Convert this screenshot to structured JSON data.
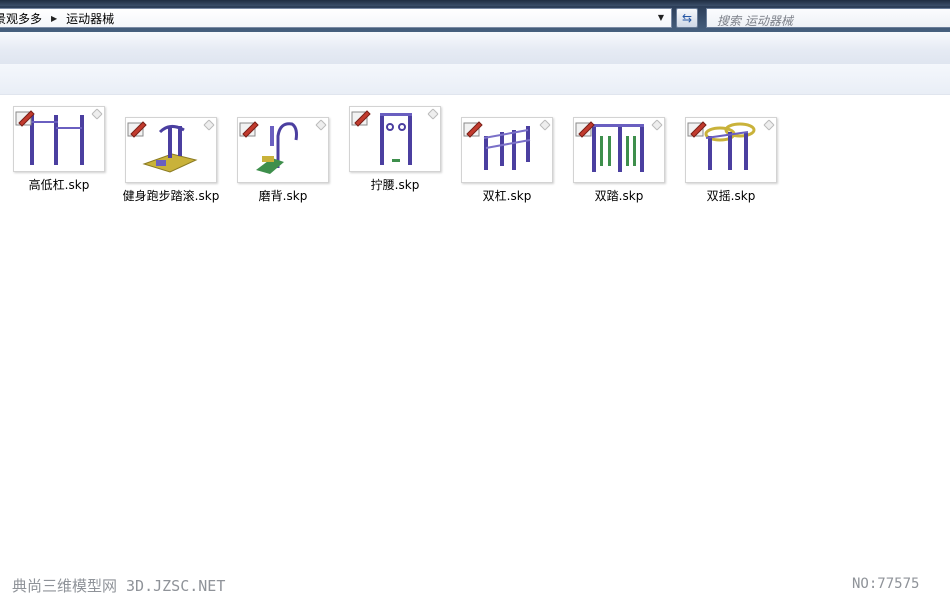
{
  "address": {
    "breadcrumbs": [
      "景观多多",
      "运动器械"
    ],
    "separator": "▶",
    "dropdown_icon": "▼",
    "refresh_icon": "⇆"
  },
  "search": {
    "placeholder": "搜索 运动器械"
  },
  "files": [
    {
      "name": "高低杠.skp",
      "icon": "high-low-bars-thumbnail"
    },
    {
      "name": "健身跑步踏滚.skp",
      "icon": "treadmill-thumbnail"
    },
    {
      "name": "磨背.skp",
      "icon": "back-massager-thumbnail"
    },
    {
      "name": "拧腰.skp",
      "icon": "waist-twister-thumbnail"
    },
    {
      "name": "双杠.skp",
      "icon": "parallel-bars-thumbnail"
    },
    {
      "name": "双踏.skp",
      "icon": "double-stepper-thumbnail"
    },
    {
      "name": "双摇.skp",
      "icon": "double-wheel-thumbnail"
    }
  ],
  "watermark": {
    "left": "典尚三维模型网 3D.JZSC.NET",
    "right": "NO:77575"
  },
  "colors": {
    "equipment_purple": "#4b3fa0",
    "equipment_yellow": "#c9b23a",
    "equipment_green": "#3e8f4c"
  }
}
